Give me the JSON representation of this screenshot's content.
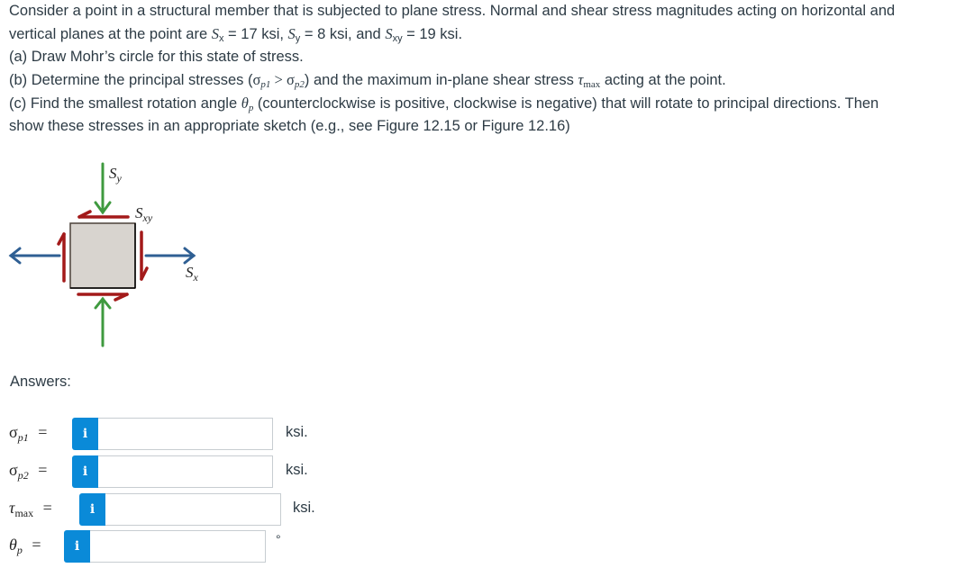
{
  "problem": {
    "line1": "Consider a point in a structural member that is subjected to plane stress. Normal and shear stress magnitudes acting on horizontal and",
    "line2_prefix": "vertical planes at the point are ",
    "sx_sym": "S",
    "sx_sub": "x",
    "sx_val": " = 17 ksi, ",
    "sy_sym": "S",
    "sy_sub": "y",
    "sy_val": " = 8 ksi, and ",
    "sxy_sym": "S",
    "sxy_sub": "xy",
    "sxy_val": " = 19 ksi.",
    "part_a": "(a) Draw Mohr’s circle for this state of stress.",
    "part_b_prefix": "(b) Determine the principal stresses (",
    "part_b_sigma1": "σ",
    "part_b_sigma1_sub": "p1",
    "part_b_gt": " > ",
    "part_b_sigma2": "σ",
    "part_b_sigma2_sub": "p2",
    "part_b_mid": ") and the maximum in-plane shear stress ",
    "part_b_tau": "τ",
    "part_b_tau_sub": "max",
    "part_b_suffix": " acting at the point.",
    "part_c_prefix": "(c) Find the smallest rotation angle ",
    "part_c_theta": "θ",
    "part_c_theta_sub": "p",
    "part_c_suffix": " (counterclockwise is positive, clockwise is negative) that will rotate to principal directions. Then",
    "part_c_line2": "show these stresses in an appropriate sketch (e.g., see Figure 12.15 or Figure 12.16)"
  },
  "diagram": {
    "label_sy": "S",
    "label_sy_sub": "y",
    "label_sxy": "S",
    "label_sxy_sub": "xy",
    "label_sx": "S",
    "label_sx_sub": "x",
    "colors": {
      "normal_y": "#3f9a3f",
      "normal_x": "#2f5f93",
      "shear": "#a31a1a",
      "element_fill": "#d8d4cf",
      "element_stroke": "#3a3a3a"
    }
  },
  "answers": {
    "label": "Answers:",
    "info_icon": "i",
    "rows": [
      {
        "symbol": "σ",
        "sub": "p1",
        "eq": " =",
        "value": "",
        "unit": "ksi."
      },
      {
        "symbol": "σ",
        "sub": "p2",
        "eq": " =",
        "value": "",
        "unit": "ksi."
      },
      {
        "symbol": "τ",
        "sub": "max",
        "eq": " =",
        "value": "",
        "unit": "ksi."
      },
      {
        "symbol": "θ",
        "sub": "p",
        "eq": " =",
        "value": "",
        "unit": "°"
      }
    ]
  },
  "colors": {
    "text": "#2d3b45",
    "info_button": "#0a8ad8",
    "input_border": "#c7cdd1"
  }
}
